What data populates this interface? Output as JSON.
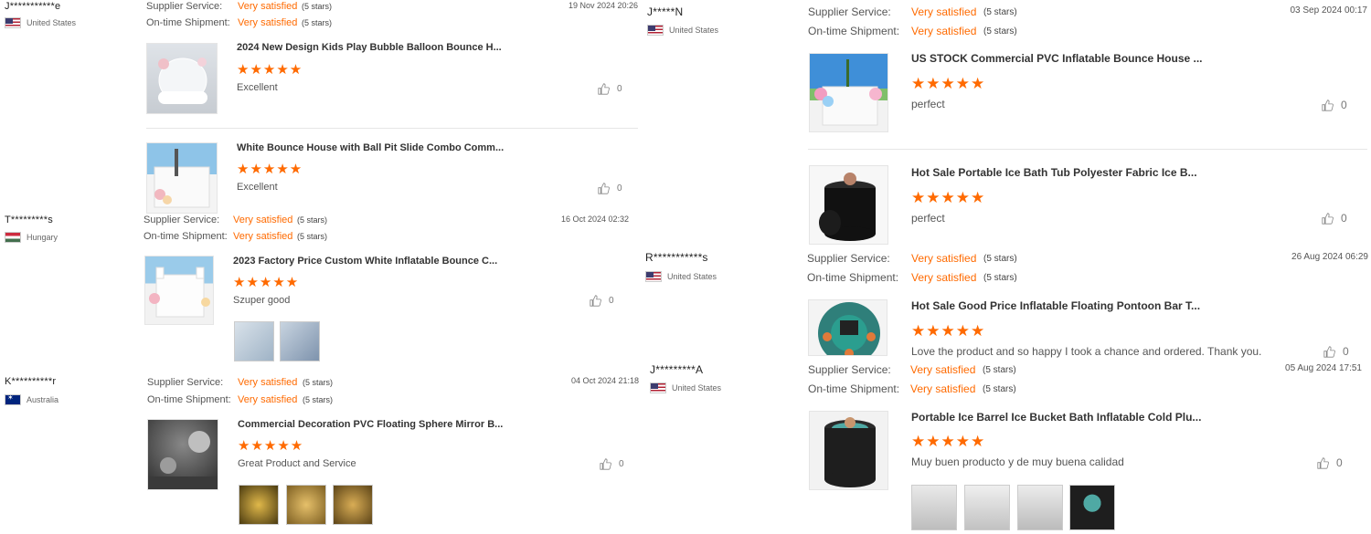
{
  "labels": {
    "supplier_service": "Supplier Service:",
    "ontime_shipment": "On-time Shipment:",
    "very_satisfied": "Very satisfied",
    "five_stars": "(5 stars)",
    "rating_stars": "★★★★★"
  },
  "reviews": [
    {
      "user": "J***********e",
      "country": "United States",
      "date": "19 Nov 2024 20:26",
      "items": [
        {
          "title": "2024 New Design Kids Play Bubble Balloon Bounce H...",
          "rating": 5,
          "text": "Excellent",
          "likes": "0"
        },
        {
          "title": "White Bounce House with Ball Pit Slide Combo Comm...",
          "rating": 5,
          "text": "Excellent",
          "likes": "0"
        }
      ]
    },
    {
      "user": "T*********s",
      "country": "Hungary",
      "date": "16 Oct 2024 02:32",
      "items": [
        {
          "title": "2023 Factory Price Custom White Inflatable Bounce C...",
          "rating": 5,
          "text": "Szuper good",
          "likes": "0"
        }
      ]
    },
    {
      "user": "K**********r",
      "country": "Australia",
      "date": "04 Oct 2024 21:18",
      "items": [
        {
          "title": "Commercial Decoration PVC Floating Sphere Mirror B...",
          "rating": 5,
          "text": "Great Product and Service",
          "likes": "0"
        }
      ]
    },
    {
      "user": "J*****N",
      "country": "United States",
      "date": "03 Sep 2024 00:17",
      "items": [
        {
          "title": "US STOCK Commercial PVC Inflatable Bounce House ...",
          "rating": 5,
          "text": "perfect",
          "likes": "0"
        },
        {
          "title": "Hot Sale Portable Ice Bath Tub Polyester Fabric Ice B...",
          "rating": 5,
          "text": "perfect",
          "likes": "0"
        }
      ]
    },
    {
      "user": "R***********s",
      "country": "United States",
      "date": "26 Aug 2024 06:29",
      "items": [
        {
          "title": "Hot Sale Good Price Inflatable Floating Pontoon Bar T...",
          "rating": 5,
          "text": "Love the product and so happy I took a chance and ordered. Thank you.",
          "likes": "0"
        }
      ]
    },
    {
      "user": "J*********A",
      "country": "United States",
      "date": "05 Aug 2024 17:51",
      "items": [
        {
          "title": "Portable Ice Barrel Ice Bucket Bath Inflatable Cold Plu...",
          "rating": 5,
          "text": "Muy buen producto y de muy buena calidad",
          "likes": "0"
        }
      ]
    }
  ],
  "colors": {
    "accent": "#ff6a00",
    "text": "#333333",
    "muted": "#666666",
    "divider": "#e6e6e6"
  },
  "icons": {
    "like": "thumbs-up-icon",
    "flag_us": "us-flag-icon",
    "flag_hu": "hungary-flag-icon",
    "flag_au": "australia-flag-icon"
  }
}
